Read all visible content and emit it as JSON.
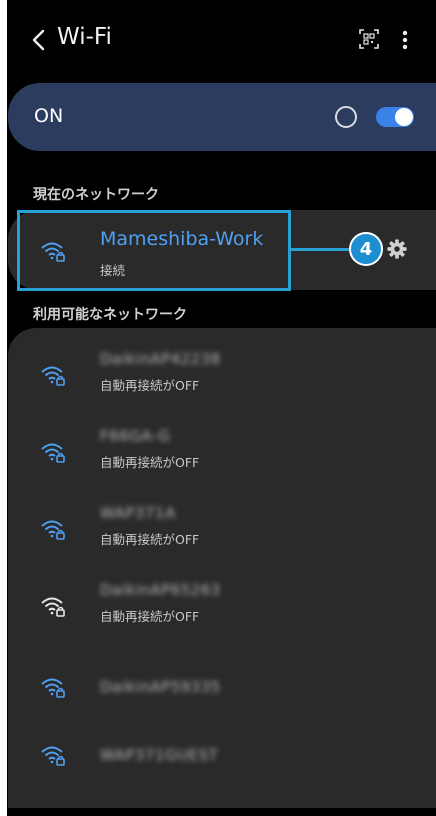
{
  "app_bar": {
    "title": "Wi-Fi",
    "icons": [
      "back-icon",
      "qr-scan-icon",
      "more-vert-icon"
    ]
  },
  "wifi_toggle": {
    "label": "ON",
    "enabled": true,
    "accent_color": "#3a82e8"
  },
  "current_section": {
    "header": "現在のネットワーク",
    "network": {
      "name": "Mameshiba-Work",
      "status": "接続",
      "name_color": "#4fa0f3"
    },
    "step_badge": "4",
    "highlight_color": "#27a0d6"
  },
  "available_section": {
    "header": "利用可能なネットワーク",
    "networks": [
      {
        "name": "DaikinAP42238",
        "status": "自動再接続がOFF"
      },
      {
        "name": "F66GA-G",
        "status": "自動再接続がOFF"
      },
      {
        "name": "WAP371A",
        "status": "自動再接続がOFF"
      },
      {
        "name": "DaikinAP65263",
        "status": "自動再接続がOFF"
      },
      {
        "name": "DaikinAP59335",
        "status": ""
      },
      {
        "name": "WAP371GUEST",
        "status": ""
      }
    ]
  }
}
